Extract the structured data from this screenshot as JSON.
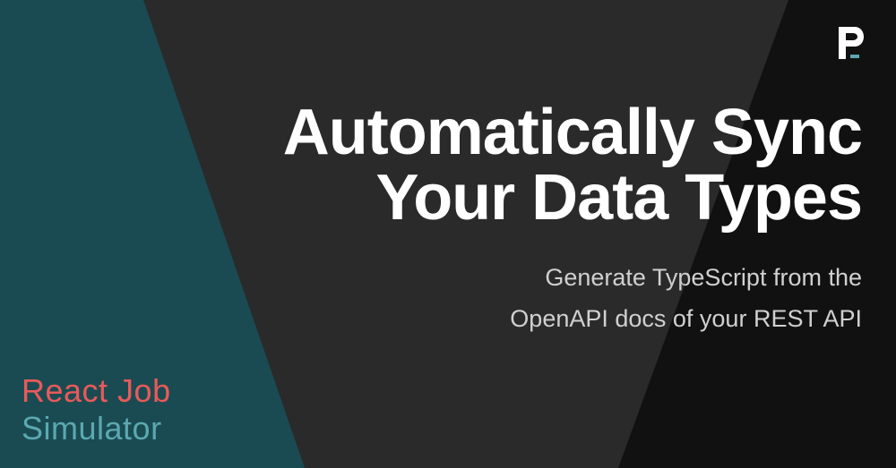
{
  "title_line1": "Automatically Sync",
  "title_line2": "Your Data Types",
  "subtitle_line1": "Generate TypeScript from the",
  "subtitle_line2": "OpenAPI docs of your REST API",
  "footer_line1": "React Job",
  "footer_line2": "Simulator",
  "colors": {
    "teal": "#1a4b52",
    "dark": "#2a2a2a",
    "black": "#111111",
    "white": "#ffffff",
    "subtitle": "#d0d0d0",
    "footer_red": "#e85a5a",
    "footer_teal": "#5ba8b0",
    "logo_accent": "#5ba8b0"
  }
}
